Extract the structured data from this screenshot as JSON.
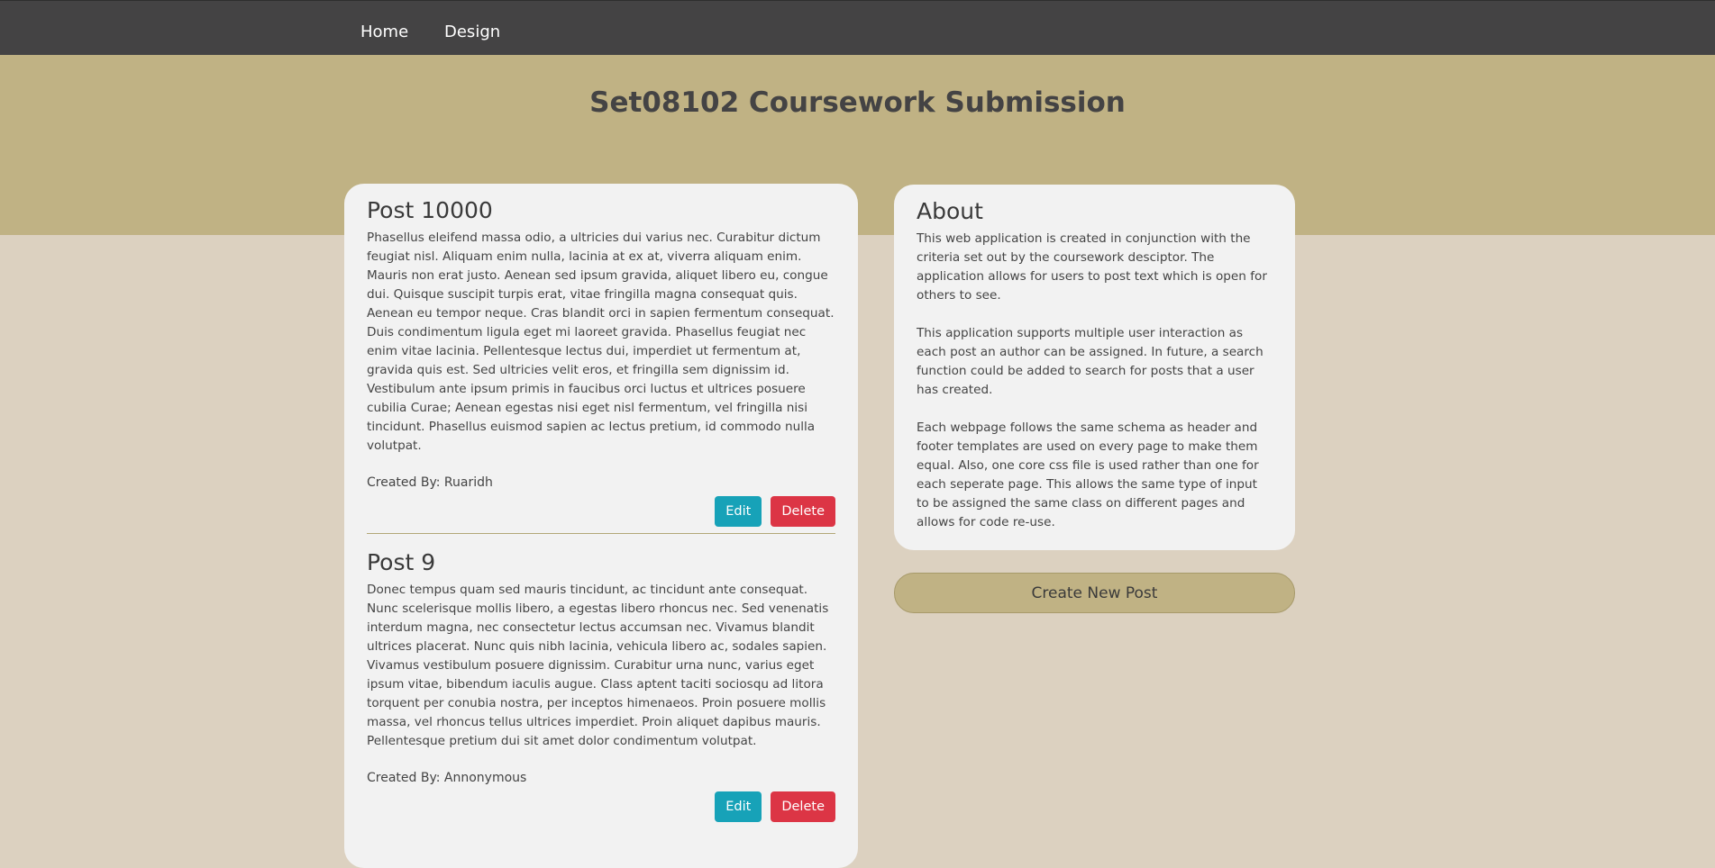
{
  "nav": {
    "items": [
      {
        "label": "Home"
      },
      {
        "label": "Design"
      }
    ]
  },
  "header": {
    "title": "Set08102 Coursework Submission"
  },
  "colors": {
    "nav_bg": "#444344",
    "banner_bg": "#c0b284",
    "page_bg": "#dcd1c0",
    "panel_bg": "#f2f2f2",
    "edit_button": "#17a2b8",
    "delete_button": "#dc3545"
  },
  "posts": [
    {
      "title": "Post 10000",
      "body": "Phasellus eleifend massa odio, a ultricies dui varius nec. Curabitur dictum feugiat nisl. Aliquam enim nulla, lacinia at ex at, viverra aliquam enim. Mauris non erat justo. Aenean sed ipsum gravida, aliquet libero eu, congue dui. Quisque suscipit turpis erat, vitae fringilla magna consequat quis. Aenean eu tempor neque. Cras blandit orci in sapien fermentum consequat. Duis condimentum ligula eget mi laoreet gravida. Phasellus feugiat nec enim vitae lacinia. Pellentesque lectus dui, imperdiet ut fermentum at, gravida quis est. Sed ultricies velit eros, et fringilla sem dignissim id. Vestibulum ante ipsum primis in faucibus orci luctus et ultrices posuere cubilia Curae; Aenean egestas nisi eget nisl fermentum, vel fringilla nisi tincidunt. Phasellus euismod sapien ac lectus pretium, id commodo nulla volutpat.",
      "author": "Created By: Ruaridh",
      "edit_label": "Edit",
      "delete_label": "Delete"
    },
    {
      "title": "Post 9",
      "body": "Donec tempus quam sed mauris tincidunt, ac tincidunt ante consequat. Nunc scelerisque mollis libero, a egestas libero rhoncus nec. Sed venenatis interdum magna, nec consectetur lectus accumsan nec. Vivamus blandit ultrices placerat. Nunc quis nibh lacinia, vehicula libero ac, sodales sapien. Vivamus vestibulum posuere dignissim. Curabitur urna nunc, varius eget ipsum vitae, bibendum iaculis augue. Class aptent taciti sociosqu ad litora torquent per conubia nostra, per inceptos himenaeos. Proin posuere mollis massa, vel rhoncus tellus ultrices imperdiet. Proin aliquet dapibus mauris. Pellentesque pretium dui sit amet dolor condimentum volutpat.",
      "author": "Created By: Annonymous",
      "edit_label": "Edit",
      "delete_label": "Delete"
    }
  ],
  "about": {
    "title": "About",
    "paragraphs": [
      "This web application is created in conjunction with the criteria set out by the coursework desciptor. The application allows for users to post text which is open for others to see.",
      "This application supports multiple user interaction as each post an author can be assigned. In future, a search function could be added to search for posts that a user has created.",
      "Each webpage follows the same schema as header and footer templates are used on every page to make them equal. Also, one core css file is used rather than one for each seperate page. This allows the same type of input to be assigned the same class on different pages and allows for code re-use."
    ]
  },
  "create_button": {
    "label": "Create New Post"
  }
}
